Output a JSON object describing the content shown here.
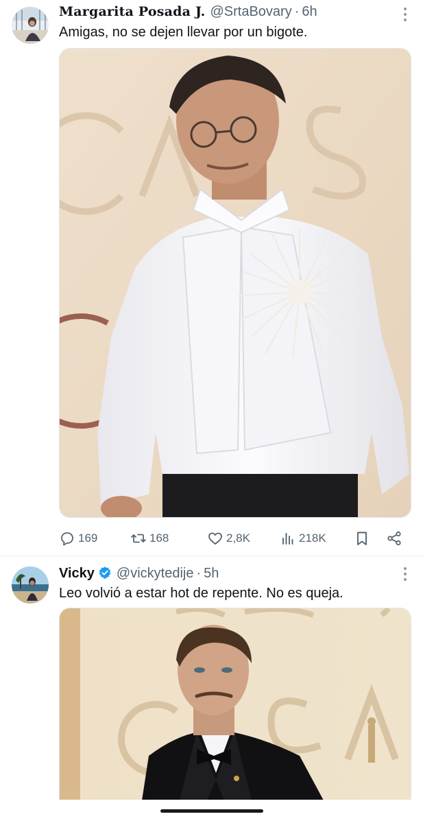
{
  "tweets": [
    {
      "name": "Margarita Posada J.",
      "handle": "@SrtaBovary",
      "separator": "·",
      "time": "6h",
      "verified": false,
      "text": "Amigas, no se dejen llevar por un bigote.",
      "photo": "man-in-white-shirt-oscars-photo",
      "stats": {
        "replies": "169",
        "retweets": "168",
        "likes": "2,8K",
        "views": "218K"
      }
    },
    {
      "name": "Vicky",
      "handle": "@vickytedije",
      "separator": "·",
      "time": "5h",
      "verified": true,
      "text": "Leo volvió a estar hot de repente. No es queja.",
      "photo": "man-in-tuxedo-oscars-photo",
      "photo_backdrop_text": "OSCAR"
    }
  ],
  "colors": {
    "text_primary": "#0f1419",
    "text_secondary": "#536471",
    "verified_blue": "#1d9bf0",
    "divider": "#e6e9eb"
  },
  "icons": [
    "more-icon",
    "reply-icon",
    "retweet-icon",
    "like-icon",
    "views-icon",
    "bookmark-icon",
    "share-icon",
    "verified-badge-icon"
  ]
}
